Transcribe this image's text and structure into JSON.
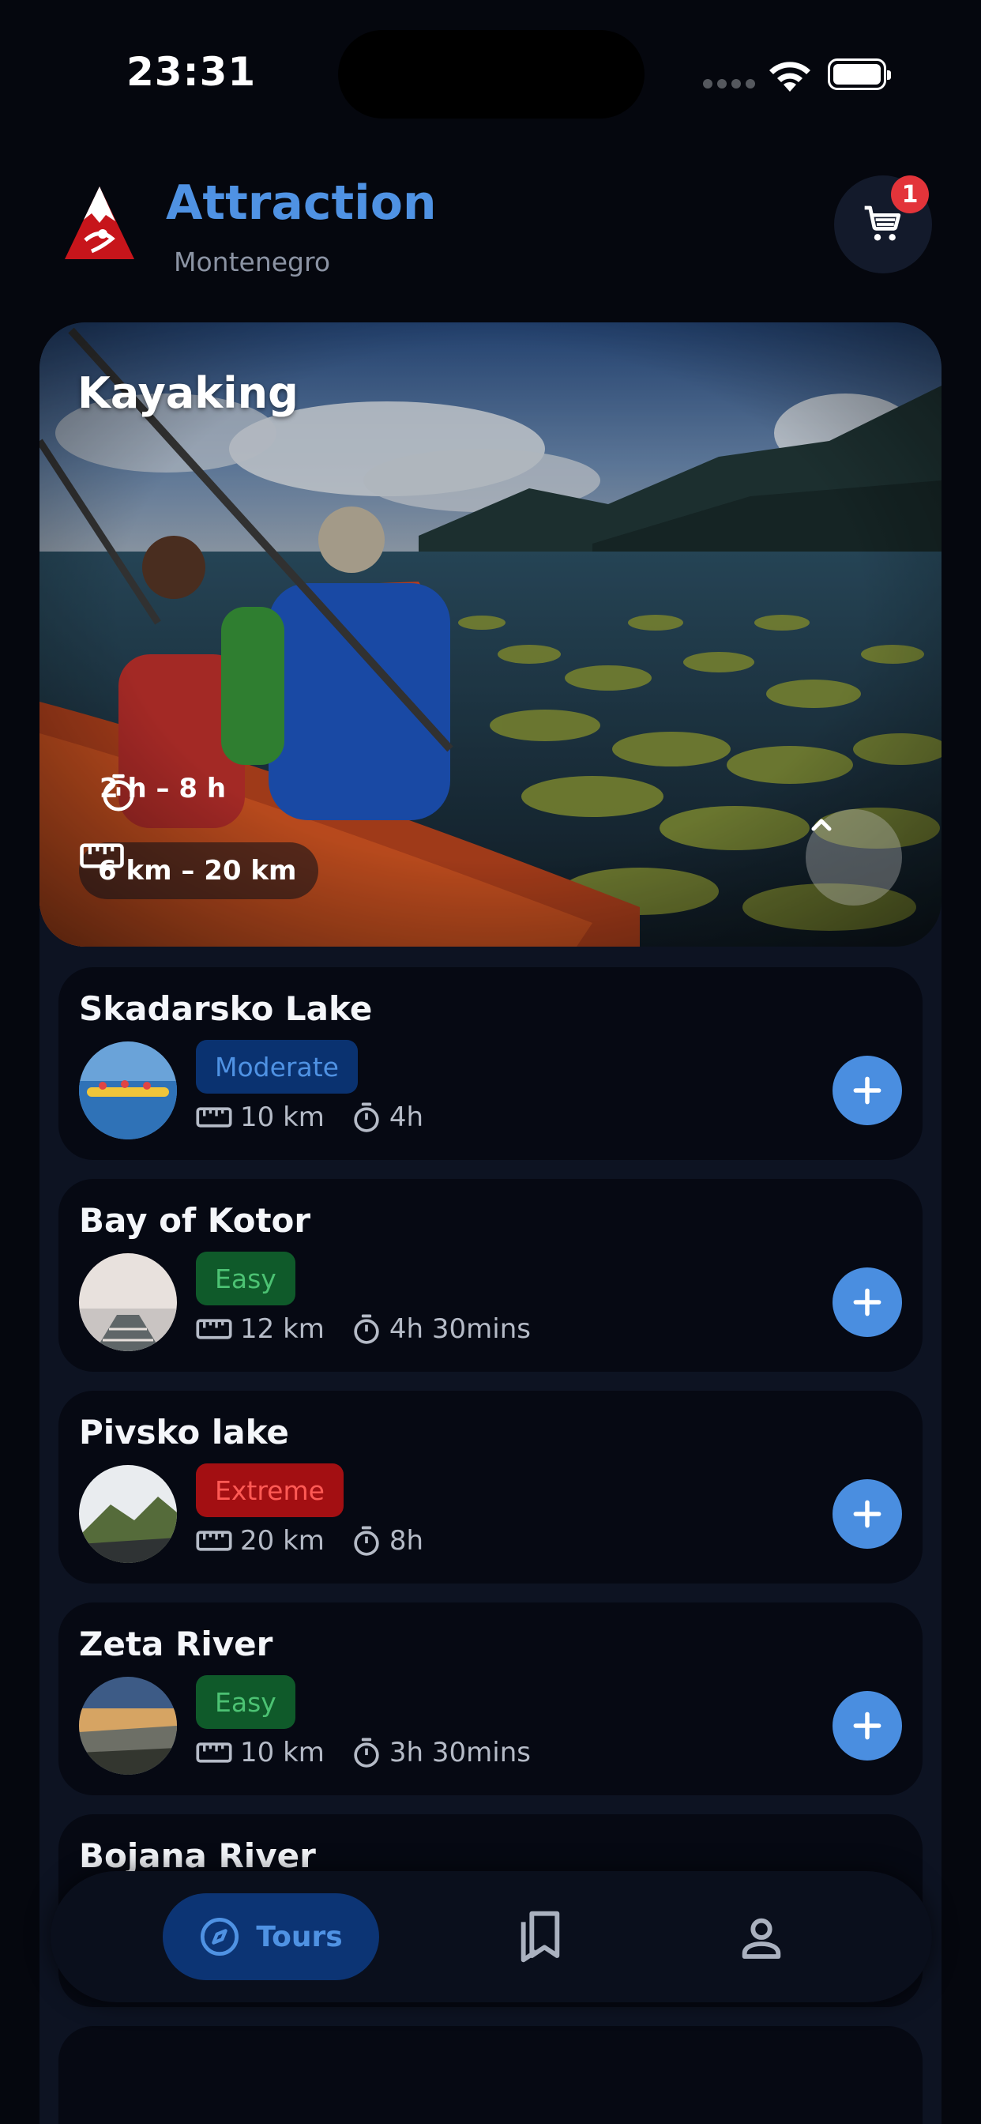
{
  "status_bar": {
    "time": "23:31"
  },
  "header": {
    "title": "Attraction",
    "subtitle": "Montenegro",
    "cart_count": "1"
  },
  "hero": {
    "title": "Kayaking",
    "duration": "2 h – 8 h",
    "distance": "6 km – 20 km"
  },
  "tours": [
    {
      "name": "Skadarsko Lake",
      "difficulty": "Moderate",
      "distance": "10 km",
      "duration": "4h"
    },
    {
      "name": "Bay of Kotor",
      "difficulty": "Easy",
      "distance": "12 km",
      "duration": "4h 30mins"
    },
    {
      "name": "Pivsko lake",
      "difficulty": "Extreme",
      "distance": "20 km",
      "duration": "8h"
    },
    {
      "name": "Zeta River",
      "difficulty": "Easy",
      "distance": "10 km",
      "duration": "3h 30mins"
    },
    {
      "name": "Bojana River"
    }
  ],
  "bottom_nav": {
    "tours_label": "Tours"
  },
  "colors": {
    "accent": "#4f92e3",
    "moderate": "#0a3270",
    "easy": "#0f5a2a",
    "extreme": "#a30f12"
  }
}
